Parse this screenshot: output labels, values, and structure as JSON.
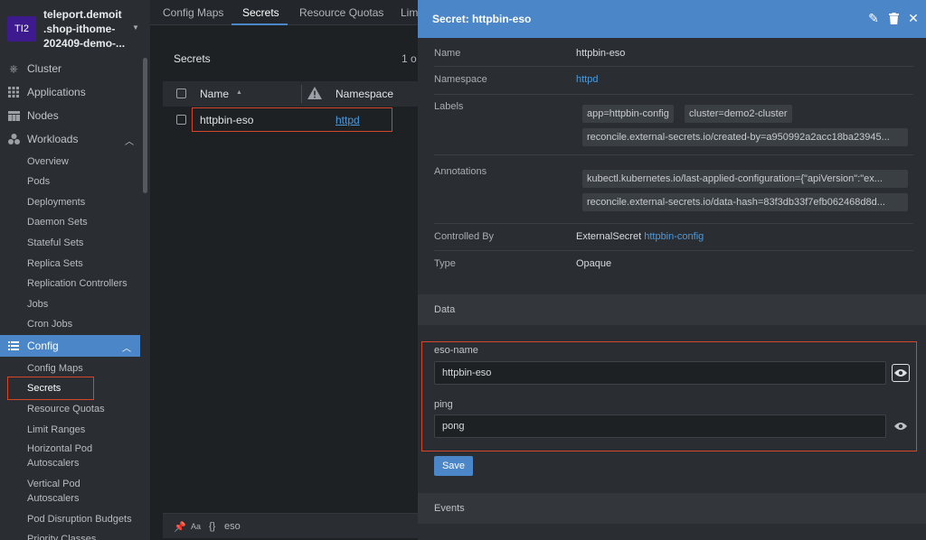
{
  "sidebar": {
    "cluster": {
      "avatar": "TI2",
      "name": "teleport.demoit\n.shop-ithome-\n202409-demo-..."
    },
    "nav": [
      {
        "label": "Cluster",
        "icon": "cluster-icon"
      },
      {
        "label": "Applications",
        "icon": "apps-grid-icon"
      },
      {
        "label": "Nodes",
        "icon": "nodes-icon"
      },
      {
        "label": "Workloads",
        "icon": "workloads-icon"
      }
    ],
    "workloads_items": [
      "Overview",
      "Pods",
      "Deployments",
      "Daemon Sets",
      "Stateful Sets",
      "Replica Sets",
      "Replication Controllers",
      "Jobs",
      "Cron Jobs"
    ],
    "config": {
      "label": "Config",
      "icon": "list-icon"
    },
    "config_items": [
      "Config Maps",
      "Secrets",
      "Resource Quotas",
      "Limit Ranges",
      "Horizontal Pod\nAutoscalers",
      "Vertical Pod\nAutoscalers",
      "Pod Disruption Budgets",
      "Priority Classes"
    ]
  },
  "tabs": [
    "Config Maps",
    "Secrets",
    "Resource Quotas",
    "Lim"
  ],
  "list": {
    "title": "Secrets",
    "count": "1 o",
    "columns": {
      "name": "Name",
      "namespace": "Namespace"
    },
    "rows": [
      {
        "name": "httpbin-eso",
        "namespace": "httpd"
      }
    ],
    "filter": {
      "aa": "Aa",
      "braces": "{}",
      "value": "eso"
    }
  },
  "detail": {
    "title": "Secret: httpbin-eso",
    "name_label": "Name",
    "name_value": "httpbin-eso",
    "namespace_label": "Namespace",
    "namespace_value": "httpd",
    "labels_label": "Labels",
    "labels": [
      "app=httpbin-config",
      "cluster=demo2-cluster",
      "reconcile.external-secrets.io/created-by=a950992a2acc18ba23945..."
    ],
    "annotations_label": "Annotations",
    "annotations": [
      "kubectl.kubernetes.io/last-applied-configuration={\"apiVersion\":\"ex...",
      "reconcile.external-secrets.io/data-hash=83f3db33f7efb062468d8d..."
    ],
    "controlled_by_label": "Controlled By",
    "controlled_by_kind": "ExternalSecret",
    "controlled_by_link": "httpbin-config",
    "type_label": "Type",
    "type_value": "Opaque",
    "data_section": "Data",
    "data_fields": [
      {
        "key": "eso-name",
        "value": "httpbin-eso"
      },
      {
        "key": "ping",
        "value": "pong"
      }
    ],
    "save_label": "Save",
    "events_section": "Events"
  },
  "colors": {
    "accent": "#4a86c8",
    "highlight": "#d8452a",
    "link": "#4a9ae0"
  }
}
